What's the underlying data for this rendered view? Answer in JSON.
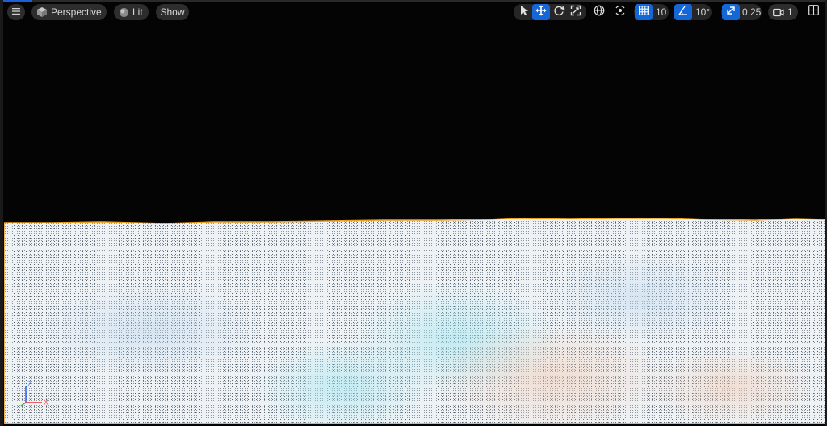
{
  "toolbar": {
    "menu_icon": "hamburger-menu-icon",
    "view_mode": {
      "label": "Perspective",
      "icon": "cube-icon"
    },
    "lighting": {
      "label": "Lit",
      "icon": "sphere-icon"
    },
    "show": {
      "label": "Show"
    },
    "transform_tools": [
      {
        "name": "select",
        "icon": "cursor-icon",
        "active": false
      },
      {
        "name": "translate",
        "icon": "move-arrows-icon",
        "active": true
      },
      {
        "name": "rotate",
        "icon": "rotate-icon",
        "active": false
      },
      {
        "name": "scale",
        "icon": "scale-icon",
        "active": false
      }
    ],
    "coordinate_space_icon": "globe-icon",
    "surface_snap_icon": "surface-snap-icon",
    "grid_snap": {
      "value": "10",
      "icon": "grid-icon",
      "enabled": true
    },
    "rotation_snap": {
      "value": "10°",
      "icon": "angle-icon",
      "enabled": true
    },
    "scale_snap": {
      "value": "0.25",
      "icon": "scale-snap-icon",
      "enabled": true
    },
    "camera_speed": {
      "value": "1",
      "icon": "camera-icon"
    },
    "layout_icon": "viewport-layout-icon"
  },
  "axis_gizmo": {
    "x_label": "X",
    "z_label": "Z"
  },
  "colors": {
    "accent": "#1566d6",
    "selection_outline": "#f0a020",
    "toolbar_pill": "#2d2d2d",
    "background": "#040404"
  }
}
